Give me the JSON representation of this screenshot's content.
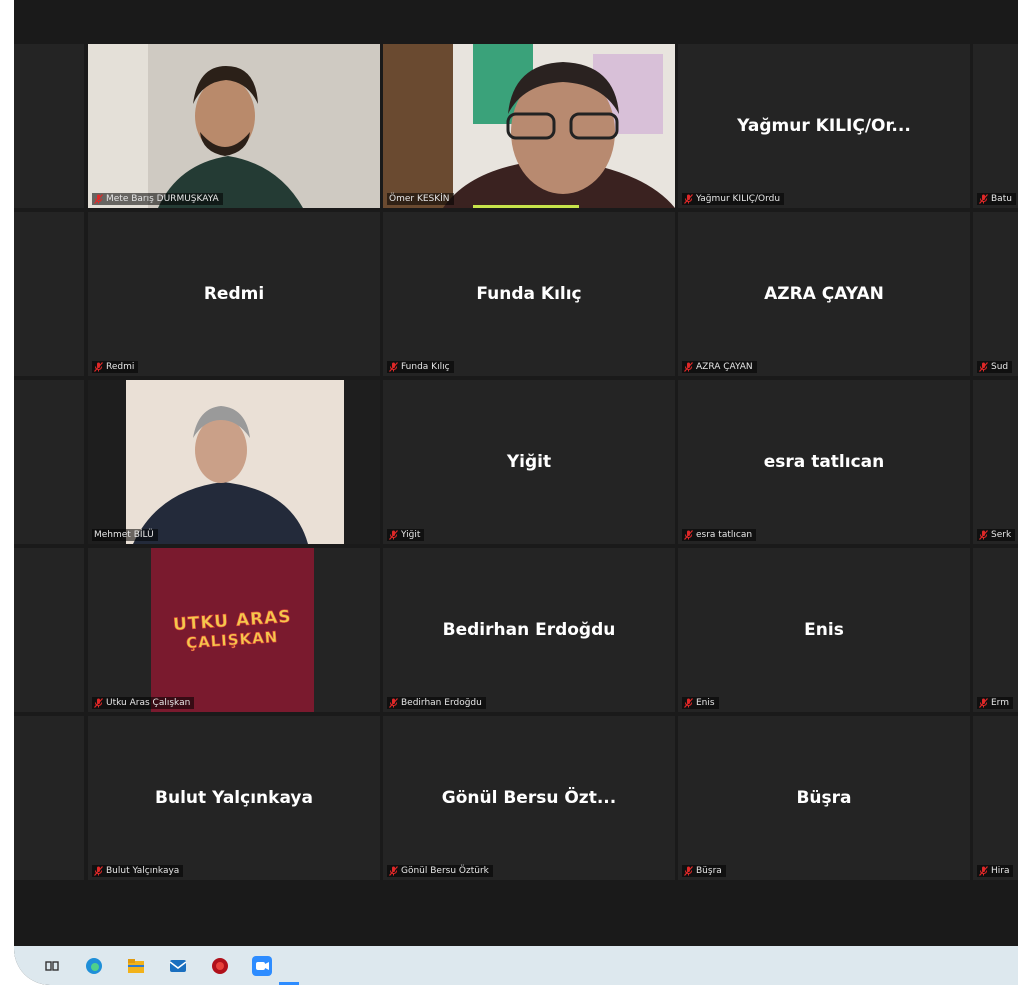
{
  "participants": [
    {
      "tile_name": "",
      "label": "Mete Barış DURMUŞKAYA",
      "video": "person-1",
      "muted": true
    },
    {
      "tile_name": "",
      "label": "Ömer KESKİN",
      "video": "person-2",
      "muted": false
    },
    {
      "tile_name": "Yağmur KILIÇ/Or...",
      "label": "Yağmur KILIÇ/Ordu",
      "muted": true
    },
    {
      "tile_name": "",
      "label": "Batu",
      "muted": true
    },
    {
      "tile_name": "Redmi",
      "label": "Redmi",
      "muted": true
    },
    {
      "tile_name": "Funda Kılıç",
      "label": "Funda Kılıç",
      "muted": true
    },
    {
      "tile_name": "AZRA ÇAYAN",
      "label": "AZRA ÇAYAN",
      "muted": true
    },
    {
      "tile_name": "",
      "label": "Sud",
      "muted": true
    },
    {
      "tile_name": "",
      "label": "Mehmet BİLÜ",
      "video": "person-3",
      "muted": false
    },
    {
      "tile_name": "Yiğit",
      "label": "Yiğit",
      "muted": true
    },
    {
      "tile_name": "esra tatlıcan",
      "label": "esra tatlıcan",
      "muted": true
    },
    {
      "tile_name": "",
      "label": "Serk",
      "muted": true
    },
    {
      "tile_name": "",
      "label": "Utku Aras Çalışkan",
      "video": "profile-picture",
      "muted": true,
      "picture_text": [
        "UTKU ARAS",
        "ÇALIŞKAN"
      ]
    },
    {
      "tile_name": "Bedirhan Erdoğdu",
      "label": "Bedirhan Erdoğdu",
      "muted": true
    },
    {
      "tile_name": "Enis",
      "label": "Enis",
      "muted": true
    },
    {
      "tile_name": "",
      "label": "Erm",
      "muted": true
    },
    {
      "tile_name": "Bulut Yalçınkaya",
      "label": "Bulut Yalçınkaya",
      "muted": true
    },
    {
      "tile_name": "Gönül Bersu Özt...",
      "label": "Gönül Bersu Öztürk",
      "muted": true
    },
    {
      "tile_name": "Büşra",
      "label": "Büşra",
      "muted": true
    },
    {
      "tile_name": "",
      "label": "Hira",
      "muted": true
    }
  ],
  "active_speaker_index": 8,
  "taskbar": {
    "icons": [
      "task-view-icon",
      "edge-icon",
      "file-explorer-icon",
      "mail-icon",
      "app-icon",
      "zoom-icon"
    ]
  },
  "colors": {
    "background": "#1a1a1a",
    "tile": "#242424",
    "active_speaker": "#c7e34a",
    "muted_mic": "#e02828",
    "taskbar": "#dde8ee",
    "picture_bg": "#7a1a2e"
  }
}
